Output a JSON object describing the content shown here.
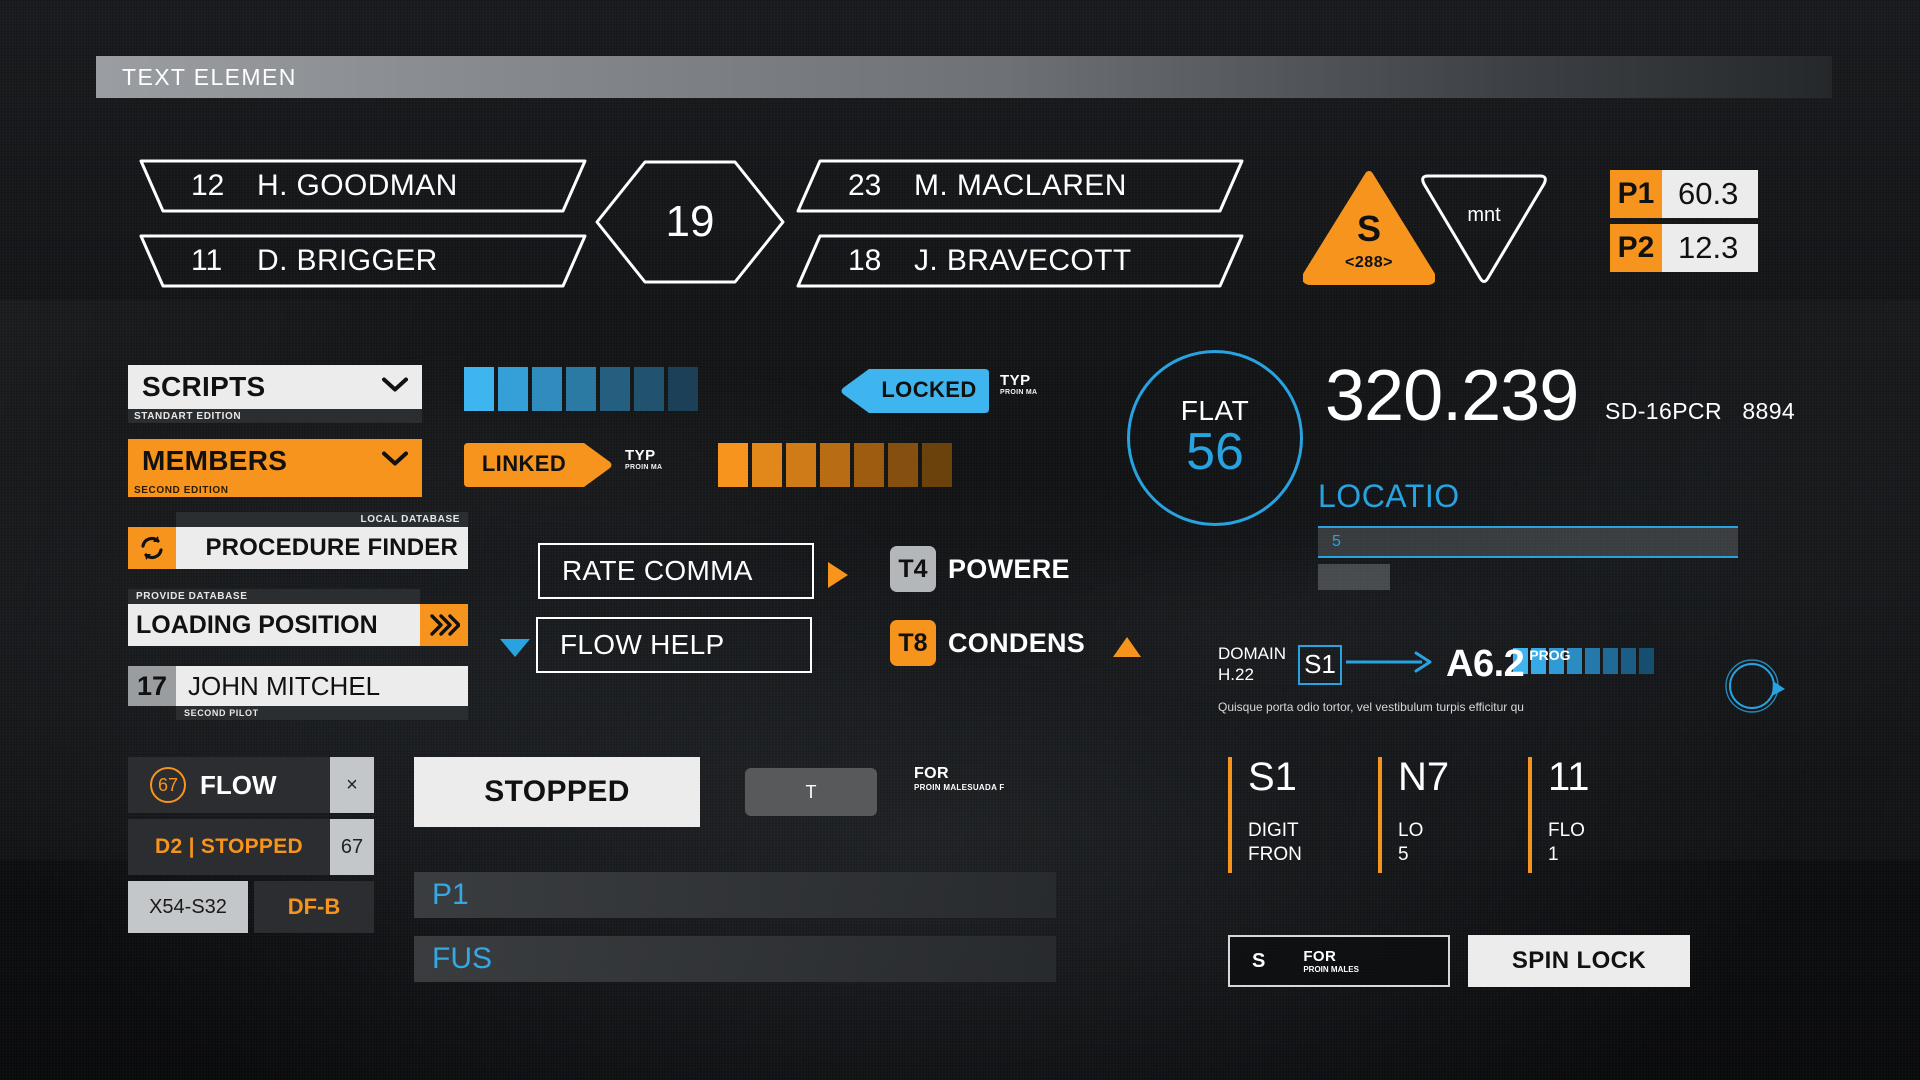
{
  "header": {
    "title": "TEXT ELEMEN"
  },
  "roster": {
    "left": [
      {
        "num": "12",
        "name": "H. GOODMAN"
      },
      {
        "num": "11",
        "name": "D. BRIGGER"
      }
    ],
    "center": {
      "value": "19"
    },
    "right": [
      {
        "num": "23",
        "name": "M. MACLAREN"
      },
      {
        "num": "18",
        "name": "J. BRAVECOTT"
      }
    ]
  },
  "warning": {
    "triangle_letter": "S",
    "triangle_sub": "<288>",
    "outline_label": "mnt",
    "accent": "#f7941e"
  },
  "pressure": [
    {
      "key": "P1",
      "value": "60.3"
    },
    {
      "key": "P2",
      "value": "12.3"
    }
  ],
  "dropdowns": [
    {
      "label": "SCRIPTS",
      "caption": "STANDART EDITION",
      "style": "light"
    },
    {
      "label": "MEMBERS",
      "caption": "SECOND EDITION",
      "style": "orange"
    }
  ],
  "procedure": {
    "finder": {
      "caption": "LOCAL DATABASE",
      "label": "PROCEDURE FINDER",
      "icon": "refresh-icon"
    },
    "loading": {
      "caption": "PROVIDE DATABASE",
      "label": "LOADING POSITION",
      "icon": "double-chevron-icon"
    },
    "pilot": {
      "num": "17",
      "name": "JOHN MITCHEL",
      "caption": "SECOND PILOT"
    }
  },
  "segment_bars": {
    "blue": {
      "count": 7,
      "colors": [
        "#3fb5f0",
        "#35a0d8",
        "#2f8cbd",
        "#2a7aa4",
        "#255f80",
        "#21536f",
        "#1b4057"
      ]
    },
    "orange": {
      "count": 7,
      "colors": [
        "#f7941e",
        "#e2871a",
        "#cf7b17",
        "#b86c14",
        "#9e5c11",
        "#85500f",
        "#6c420c"
      ]
    },
    "progress": {
      "count": 8,
      "colors": [
        "#3fb5f0",
        "#36a9e6",
        "#2f9ad3",
        "#2a8cc0",
        "#2478aa",
        "#1f6a96",
        "#1b5d84",
        "#164e70"
      ]
    }
  },
  "tags": {
    "locked": {
      "label": "LOCKED",
      "cap_title": "TYP",
      "cap_sub": "PROIN MA",
      "color": "#3fb5f0"
    },
    "linked": {
      "label": "LINKED",
      "cap_title": "TYP",
      "cap_sub": "PROIN MA",
      "color": "#f7941e"
    }
  },
  "buttons": {
    "rate_comma": "RATE COMMA",
    "flow_help": "FLOW HELP"
  },
  "chips": [
    {
      "code": "T4",
      "label": "POWERE",
      "style": "grey"
    },
    {
      "code": "T8",
      "label": "CONDENS",
      "style": "orange"
    }
  ],
  "flat": {
    "title": "FLAT",
    "value": "56",
    "color": "#29a3e0"
  },
  "readout": {
    "big": "320.239",
    "code": "SD-16PCR",
    "num": "8894"
  },
  "location": {
    "title": "LOCATIO",
    "bar_value": "5"
  },
  "domain": {
    "title": "DOMAIN",
    "sub": "H.22",
    "state": "S1",
    "value": "A6.2",
    "value_sup": "PROG",
    "description": "Quisque porta odio tortor, vel vestibulum turpis efficitur qu"
  },
  "flow_panel": {
    "badge": "67",
    "label": "FLOW",
    "close": "×",
    "status": "D2 | STOPPED",
    "status_value": "67",
    "code_left": "X54-S32",
    "code_right": "DF-B"
  },
  "stopped_button": "STOPPED",
  "t_button": "T",
  "for_caption": {
    "title": "FOR",
    "sub": "PROIN MALESUADA F"
  },
  "wide_bars": [
    {
      "label": "P1"
    },
    {
      "label": "FUS"
    }
  ],
  "stats": [
    {
      "value": "S1",
      "line1": "DIGIT",
      "line2": "FRON"
    },
    {
      "value": "N7",
      "line1": "LO",
      "line2": "5"
    },
    {
      "value": "11",
      "line1": "FLO",
      "line2": "1"
    }
  ],
  "footer_buttons": {
    "s_for": {
      "letter": "S",
      "title": "FOR",
      "sub": "PROIN MALES"
    },
    "spin_lock": "SPIN LOCK"
  }
}
